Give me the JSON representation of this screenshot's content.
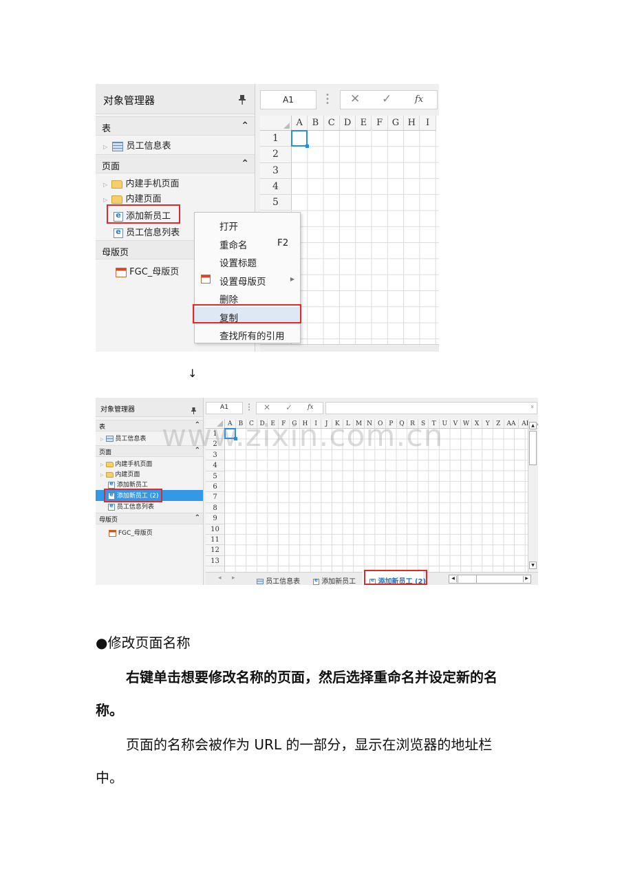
{
  "shot1": {
    "panel_title": "对象管理器",
    "pin_icon": "pin-icon",
    "sections": [
      {
        "label": "表",
        "caret": "⌃"
      },
      {
        "label": "页面",
        "caret": "⌃"
      },
      {
        "label": "母版页"
      }
    ],
    "tables": [
      {
        "label": "员工信息表",
        "icon": "table-icon"
      }
    ],
    "pages": [
      {
        "label": "内建手机页面",
        "icon": "folder-icon"
      },
      {
        "label": "内建页面",
        "icon": "folder-icon"
      },
      {
        "label": "添加新员工",
        "icon": "page-icon"
      },
      {
        "label": "员工信息列表",
        "icon": "page-icon"
      }
    ],
    "masters": [
      {
        "label": "FGC_母版页",
        "icon": "master-page-icon"
      }
    ],
    "cell_ref": "A1",
    "cancel_glyph": "✕",
    "confirm_glyph": "✓",
    "fx_glyph": "fx",
    "columns": [
      "A",
      "B",
      "C",
      "D",
      "E",
      "F",
      "G",
      "H",
      "I"
    ],
    "rows": [
      "1",
      "2",
      "3",
      "4",
      "5"
    ],
    "context_menu": [
      {
        "label": "打开"
      },
      {
        "label": "重命名",
        "shortcut": "F2"
      },
      {
        "label": "设置标题"
      },
      {
        "label": "设置母版页",
        "has_submenu": true,
        "icon": "master-page-icon"
      },
      {
        "label": "删除"
      },
      {
        "label": "复制",
        "highlighted": true
      },
      {
        "label": "查找所有的引用"
      }
    ]
  },
  "arrow": "↓",
  "shot2": {
    "panel_title": "对象管理器",
    "sections": [
      {
        "label": "表",
        "caret": "⌃"
      },
      {
        "label": "页面",
        "caret": "⌃"
      },
      {
        "label": "母版页",
        "caret": "⌃"
      }
    ],
    "tables": [
      {
        "label": "员工信息表"
      }
    ],
    "pages": [
      {
        "label": "内建手机页面"
      },
      {
        "label": "内建页面"
      },
      {
        "label": "添加新员工"
      },
      {
        "label": "添加新员工 (2)",
        "selected": true
      },
      {
        "label": "员工信息列表"
      }
    ],
    "masters": [
      {
        "label": "FGC_母版页"
      }
    ],
    "cell_ref": "A1",
    "cancel_glyph": "✕",
    "confirm_glyph": "✓",
    "fx_glyph": "fx",
    "dropdown_glyph": "»",
    "columns": [
      "A",
      "B",
      "C",
      "D",
      "E",
      "F",
      "G",
      "H",
      "I",
      "J",
      "K",
      "L",
      "M",
      "N",
      "O",
      "P",
      "Q",
      "R",
      "S",
      "T",
      "U",
      "V",
      "W",
      "X",
      "Y",
      "Z",
      "AA",
      "AB",
      "A"
    ],
    "rows": [
      "1",
      "2",
      "3",
      "4",
      "5",
      "6",
      "7",
      "8",
      "9",
      "10",
      "11",
      "12",
      "13"
    ],
    "nav_prev": "◂",
    "nav_next": "▸",
    "sheet_tabs": [
      {
        "label": "员工信息表",
        "icon": "table-icon"
      },
      {
        "label": "添加新员工",
        "icon": "page-icon"
      },
      {
        "label": "添加新员工 (2)",
        "icon": "page-icon",
        "active": true
      }
    ],
    "watermark": "www.zixin.com.cn"
  },
  "doc": {
    "heading": "●修改页面名称",
    "para1_line1": "右键单击想要修改名称的页面，然后选择重命名并设定新的名",
    "para1_line2": "称。",
    "para2_line1": "页面的名称会被作为 URL 的一部分，显示在浏览器的地址栏",
    "para2_line2": "中。"
  }
}
